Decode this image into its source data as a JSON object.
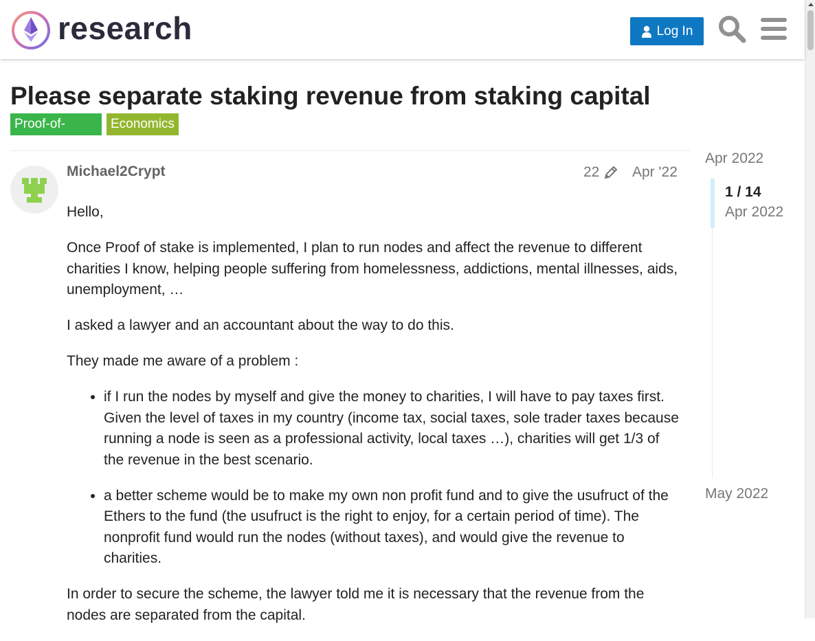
{
  "header": {
    "logo_text": "research",
    "login_label": "Log In",
    "icons": [
      "user-icon",
      "search-icon",
      "hamburger-menu-icon"
    ]
  },
  "topic": {
    "title": "Please separate staking revenue from staking capital",
    "tags": [
      "Proof-of-Stake",
      "Economics"
    ],
    "tag_colors": [
      "#3ab54a",
      "#92b72f"
    ]
  },
  "post": {
    "username": "Michael2Crypt",
    "edit_count": "22",
    "date": "Apr '22",
    "paragraphs": [
      "Hello,",
      "Once Proof of stake is implemented, I plan to run nodes and affect the revenue to different charities I know, helping people suffering from homelessness, addictions, mental illnesses, aids, unemployment, …",
      "I asked a lawyer and an accountant about the way to do this.",
      "They made me aware of a problem :"
    ],
    "list_items": [
      "if I run the nodes by myself and give the money to charities, I will have to pay taxes first. Given the level of taxes in my country (income tax, social taxes, sole trader taxes because running a node is seen as a professional activity, local taxes …), charities will get 1/3 of the revenue in the best scenario.",
      "a better scheme would be to make my own non profit fund and to give the usufruct of the Ethers to the fund (the usufruct is the right to enjoy, for a certain period of time). The nonprofit fund would run the nodes (without taxes), and would give the revenue to charities."
    ],
    "closing_paragraph": "In order to secure the scheme, the lawyer told me it is necessary that the revenue from the nodes are separated from the capital."
  },
  "timeline": {
    "start_label": "Apr 2022",
    "position": "1 / 14",
    "current_date": "Apr 2022",
    "end_label": "May 2022"
  },
  "colors": {
    "accent": "#0f78c2",
    "avatar_bg": "#efefef",
    "avatar_fg": "#8ed14f"
  }
}
